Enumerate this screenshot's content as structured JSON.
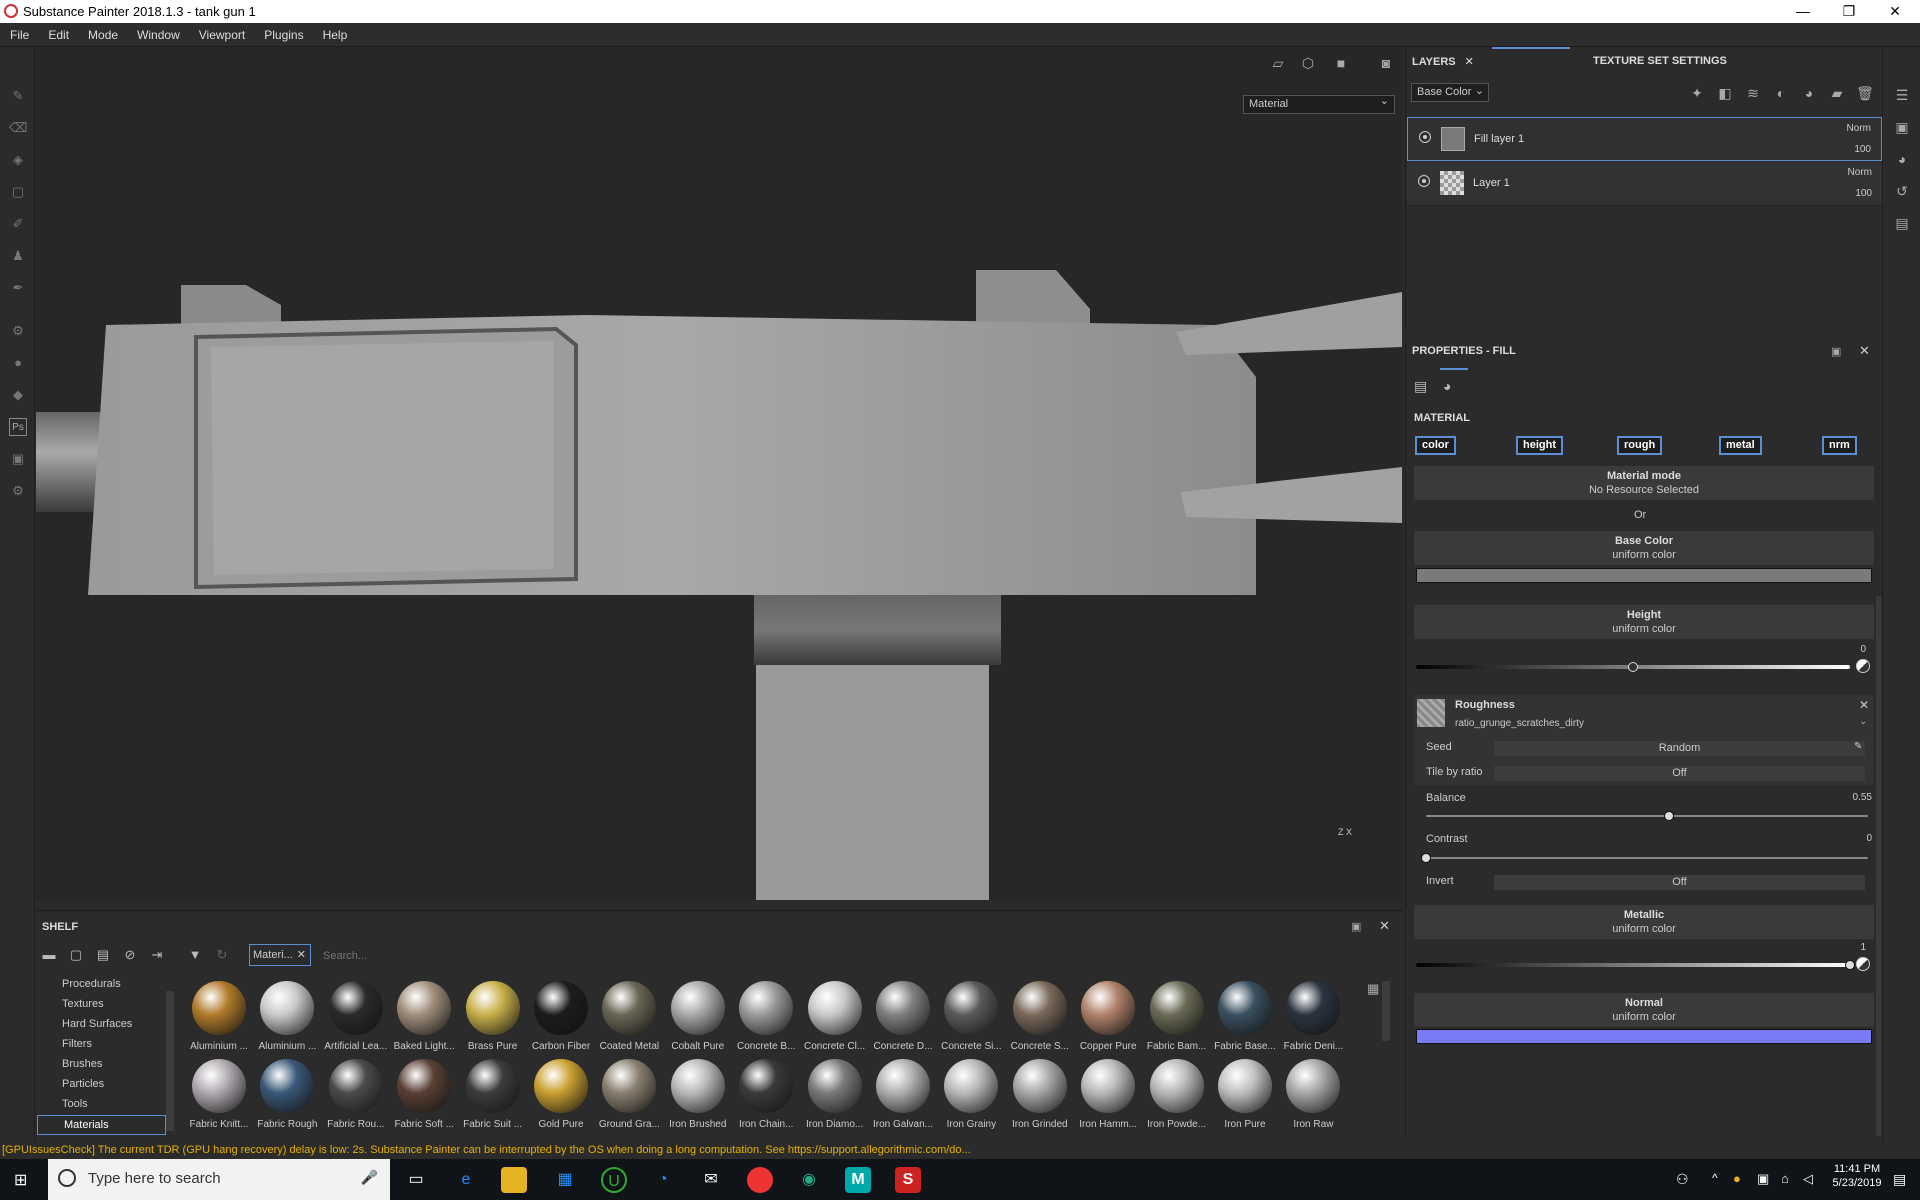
{
  "app": {
    "title": "Substance Painter 2018.1.3 - tank gun 1",
    "window_controls": [
      "—",
      "❐",
      "✕"
    ]
  },
  "menu": [
    "File",
    "Edit",
    "Mode",
    "Window",
    "Viewport",
    "Plugins",
    "Help"
  ],
  "viewport": {
    "display_mode": "Material",
    "axis_label": "Z   X"
  },
  "shelf": {
    "title": "SHELF",
    "filter_tag": "Materi...",
    "search_placeholder": "Search...",
    "categories": [
      "Procedurals",
      "Textures",
      "Hard Surfaces",
      "Filters",
      "Brushes",
      "Particles",
      "Tools",
      "Materials"
    ],
    "materials_row1": [
      "Aluminium ...",
      "Aluminium ...",
      "Artificial Lea...",
      "Baked Light...",
      "Brass Pure",
      "Carbon Fiber",
      "Coated Metal",
      "Cobalt Pure",
      "Concrete B...",
      "Concrete Cl...",
      "Concrete D...",
      "Concrete Si...",
      "Concrete S...",
      "Copper Pure",
      "Fabric Bam...",
      "Fabric Base...",
      "Fabric Deni..."
    ],
    "materials_row2": [
      "Fabric Knitt...",
      "Fabric Rough",
      "Fabric Rou...",
      "Fabric Soft ...",
      "Fabric Suit ...",
      "Gold Pure",
      "Ground Gra...",
      "Iron Brushed",
      "Iron Chain...",
      "Iron Diamo...",
      "Iron Galvan...",
      "Iron Grainy",
      "Iron Grinded",
      "Iron Hamm...",
      "Iron Powde...",
      "Iron Pure",
      "Iron Raw"
    ],
    "colors_row1": [
      "#b07a2a",
      "#c9c9c9",
      "#2a2a2a",
      "#a08e7c",
      "#c9b04a",
      "#1c1c1c",
      "#6a6656",
      "#a8a8a8",
      "#9a9a9a",
      "#c9c9c9",
      "#808080",
      "#5a5a5a",
      "#7a6a5a",
      "#b0826a",
      "#6a6a56",
      "#3a5060",
      "#2a3440"
    ],
    "colors_row2": [
      "#b0aab0",
      "#3a5878",
      "#4a4a4a",
      "#5a4034",
      "#3c3c3c",
      "#c9a030",
      "#8a8070",
      "#b8b8b8",
      "#3a3a3a",
      "#7a7a7a",
      "#b0b0b0",
      "#b8b8b8",
      "#a8a8a8",
      "#b8b8b8",
      "#b8b8b8",
      "#c0c0c0",
      "#a8a8a8"
    ]
  },
  "status_message": "[GPUIssuesCheck] The current TDR (GPU hang recovery) delay is low: 2s. Substance Painter can be interrupted by the OS when doing a long computation. See https://support.allegorithmic.com/do...",
  "layers": {
    "tab_layers": "LAYERS",
    "tab_tss": "TEXTURE SET SETTINGS",
    "channel_select": "Base Color",
    "items": [
      {
        "name": "Fill layer 1",
        "blend": "Norm",
        "opacity": "100"
      },
      {
        "name": "Layer 1",
        "blend": "Norm",
        "opacity": "100"
      }
    ]
  },
  "properties": {
    "title": "PROPERTIES - FILL",
    "section": "MATERIAL",
    "channels": [
      "color",
      "height",
      "rough",
      "metal",
      "nrm"
    ],
    "material_mode": {
      "title": "Material mode",
      "sub": "No Resource Selected"
    },
    "or": "Or",
    "base_color": {
      "title": "Base Color",
      "sub": "uniform color",
      "color": "#7a7a7a"
    },
    "height": {
      "title": "Height",
      "sub": "uniform color",
      "value": "0",
      "level": 0.5
    },
    "roughness": {
      "title": "Roughness",
      "resource": "ratio_grunge_scratches_dirty"
    },
    "seed": {
      "label": "Seed",
      "value": "Random"
    },
    "tile_by_ratio": {
      "label": "Tile by ratio",
      "value": "Off"
    },
    "balance": {
      "label": "Balance",
      "value": "0.55",
      "level": 0.55
    },
    "contrast": {
      "label": "Contrast",
      "value": "0",
      "level": 0
    },
    "invert": {
      "label": "Invert",
      "value": "Off"
    },
    "metallic": {
      "title": "Metallic",
      "sub": "uniform color",
      "value": "1",
      "level": 1
    },
    "normal": {
      "title": "Normal",
      "sub": "uniform color",
      "color": "#7a7af5"
    }
  },
  "taskbar": {
    "search_placeholder": "Type here to search",
    "time": "11:41 PM",
    "date": "5/23/2019"
  }
}
